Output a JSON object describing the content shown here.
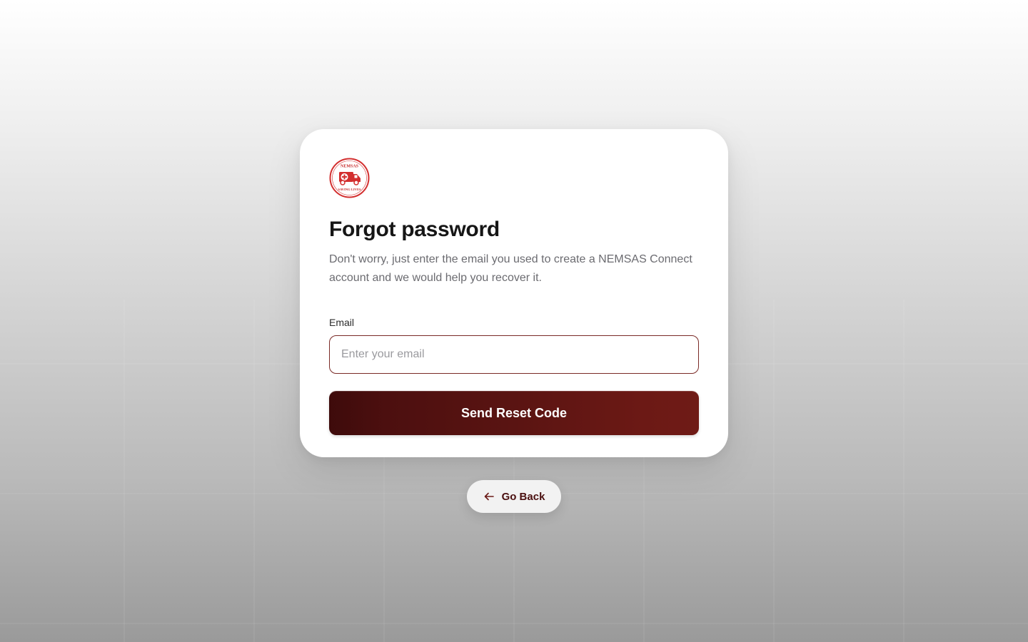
{
  "card": {
    "title": "Forgot password",
    "subtitle": "Don't worry, just enter the email you used to create a NEMSAS Connect account and we would help you recover it.",
    "logo": {
      "icon": "ambulance-logo-icon",
      "top_text": "NEMSAS",
      "bottom_text": "SAVING LIVES"
    }
  },
  "form": {
    "email_label": "Email",
    "email_value": "",
    "email_placeholder": "Enter your email",
    "submit_label": "Send Reset Code"
  },
  "nav": {
    "back_label": "Go Back",
    "back_icon": "arrow-left-icon"
  },
  "colors": {
    "brand_dark": "#4a0f0f",
    "brand": "#6f1b16",
    "logo_red": "#d32f2f"
  }
}
